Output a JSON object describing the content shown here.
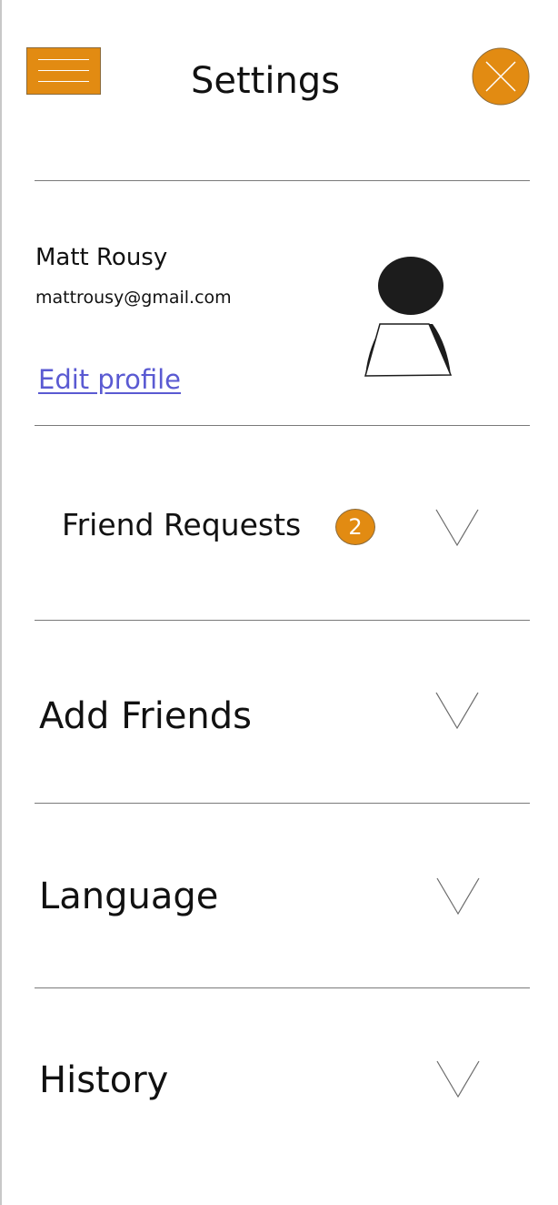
{
  "header": {
    "title": "Settings",
    "menu_icon": "hamburger-menu-icon",
    "close_icon": "close-icon",
    "accent_color": "#e28b12"
  },
  "profile": {
    "name": "Matt Rousy",
    "email": "mattrousy@gmail.com",
    "edit_label": "Edit profile",
    "avatar_icon": "user-avatar-icon",
    "link_color": "#5a5ad2"
  },
  "rows": [
    {
      "label": "Friend Requests",
      "badge": "2",
      "icon": "chevron-down-icon"
    },
    {
      "label": "Add Friends",
      "icon": "chevron-down-icon"
    },
    {
      "label": "Language",
      "icon": "chevron-down-icon"
    },
    {
      "label": "History",
      "icon": "chevron-down-icon"
    }
  ]
}
